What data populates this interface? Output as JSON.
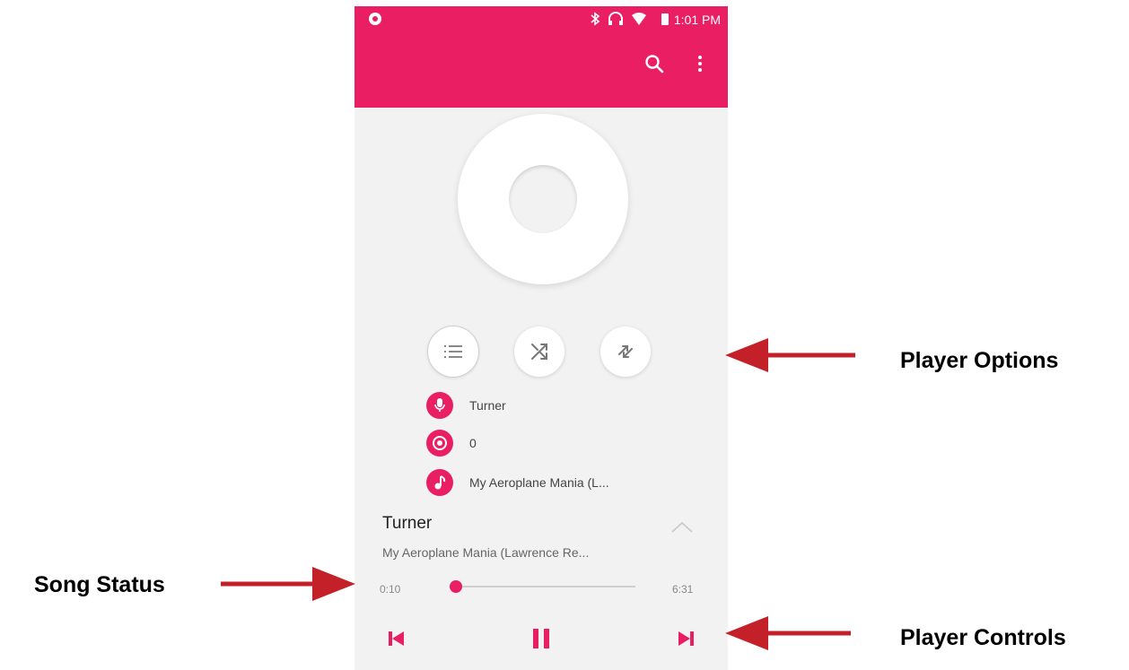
{
  "statusbar": {
    "time": "1:01 PM"
  },
  "appbar": {
    "search_icon": "search-icon",
    "more_icon": "more-vert-icon"
  },
  "player_options": {
    "playlist_icon": "playlist-icon",
    "shuffle_icon": "shuffle-icon",
    "repeat_icon": "repeat-icon"
  },
  "info": {
    "artist": "Turner",
    "album": "0",
    "song": "My Aeroplane Mania (L..."
  },
  "now_playing": {
    "title": "Turner",
    "subtitle": "My Aeroplane Mania (Lawrence Re...",
    "elapsed": "0:10",
    "duration": "6:31",
    "progress_fraction": 0.026
  },
  "controls": {
    "prev_icon": "skip-previous-icon",
    "pause_icon": "pause-icon",
    "next_icon": "skip-next-icon"
  },
  "callouts": {
    "player_options": "Player Options",
    "song_status": "Song Status",
    "player_controls": "Player Controls"
  },
  "colors": {
    "accent": "#e91e63",
    "arrow": "#c3202a"
  }
}
